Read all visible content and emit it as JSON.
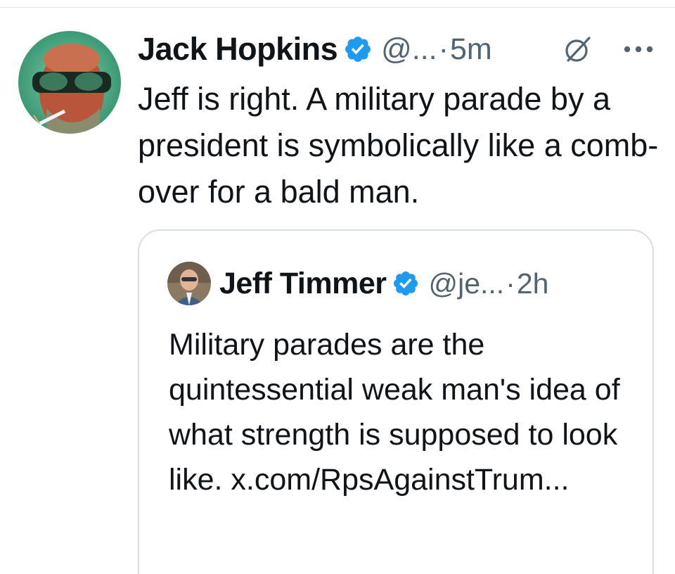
{
  "tweet": {
    "author_name": "Jack Hopkins",
    "handle": "@...",
    "separator": "·",
    "time": "5m",
    "text": "Jeff is right. A military parade by a president is symbolically like a comb-over for a bald man.",
    "verified_icon": "verified-badge-icon",
    "grok_icon": "grok-icon",
    "more_icon": "more-options-icon"
  },
  "quote": {
    "author_name": "Jeff Timmer",
    "handle": "@je...",
    "separator": "·",
    "time": "2h",
    "text": "Military parades are the quintessential weak man's idea of what strength is supposed to look like. x.com/RpsAgainstTrum...",
    "verified_icon": "verified-badge-icon"
  },
  "colors": {
    "text_primary": "#0f1419",
    "text_secondary": "#536471",
    "verified_blue": "#1d9bf0",
    "border": "#d8dfe4"
  }
}
